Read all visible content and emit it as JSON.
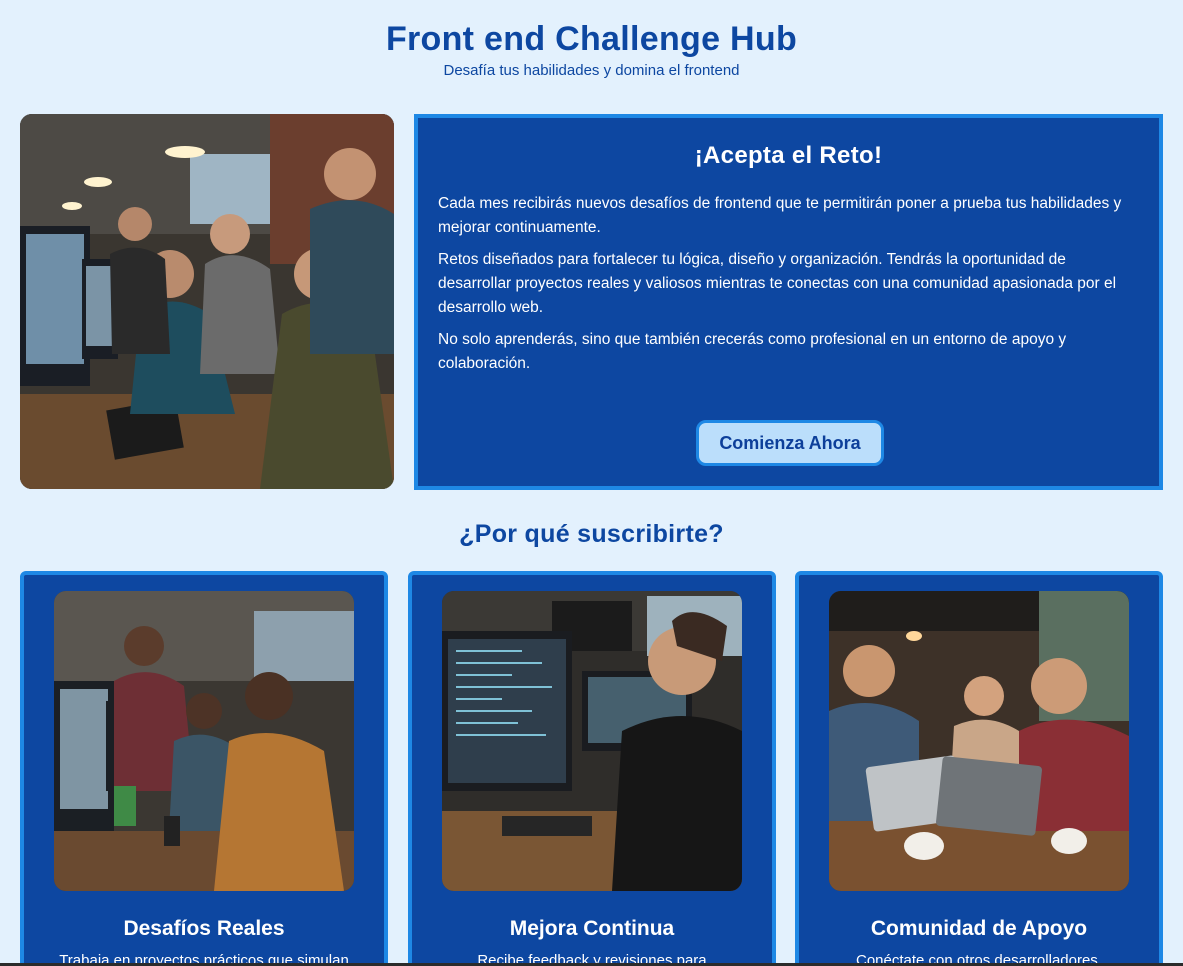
{
  "header": {
    "title": "Front end Challenge Hub",
    "subtitle": "Desafía tus habilidades y domina el frontend"
  },
  "hero": {
    "image_alt": "Jóvenes desarrolladores programando frente a computadoras",
    "heading": "¡Acepta el Reto!",
    "paragraphs": [
      "Cada mes recibirás nuevos desafíos de frontend que te permitirán poner a prueba tus habilidades y mejorar continuamente.",
      "Retos diseñados para fortalecer tu lógica, diseño y organización. Tendrás la oportunidad de desarrollar proyectos reales y valiosos mientras te conectas con una comunidad apasionada por el desarrollo web.",
      "No solo aprenderás, sino que también crecerás como profesional en un entorno de apoyo y colaboración."
    ],
    "cta_label": "Comienza Ahora"
  },
  "why": {
    "title": "¿Por qué suscribirte?",
    "cards": [
      {
        "title": "Desafíos Reales",
        "desc": "Trabaja en proyectos prácticos que simulan"
      },
      {
        "title": "Mejora Continua",
        "desc": "Recibe feedback y revisiones para"
      },
      {
        "title": "Comunidad de Apoyo",
        "desc": "Conéctate con otros desarrolladores,"
      }
    ]
  },
  "colors": {
    "background": "#e3f1fd",
    "primary": "#0d47a1",
    "border_accent": "#1e88e5",
    "button_bg": "#bbdefb"
  }
}
